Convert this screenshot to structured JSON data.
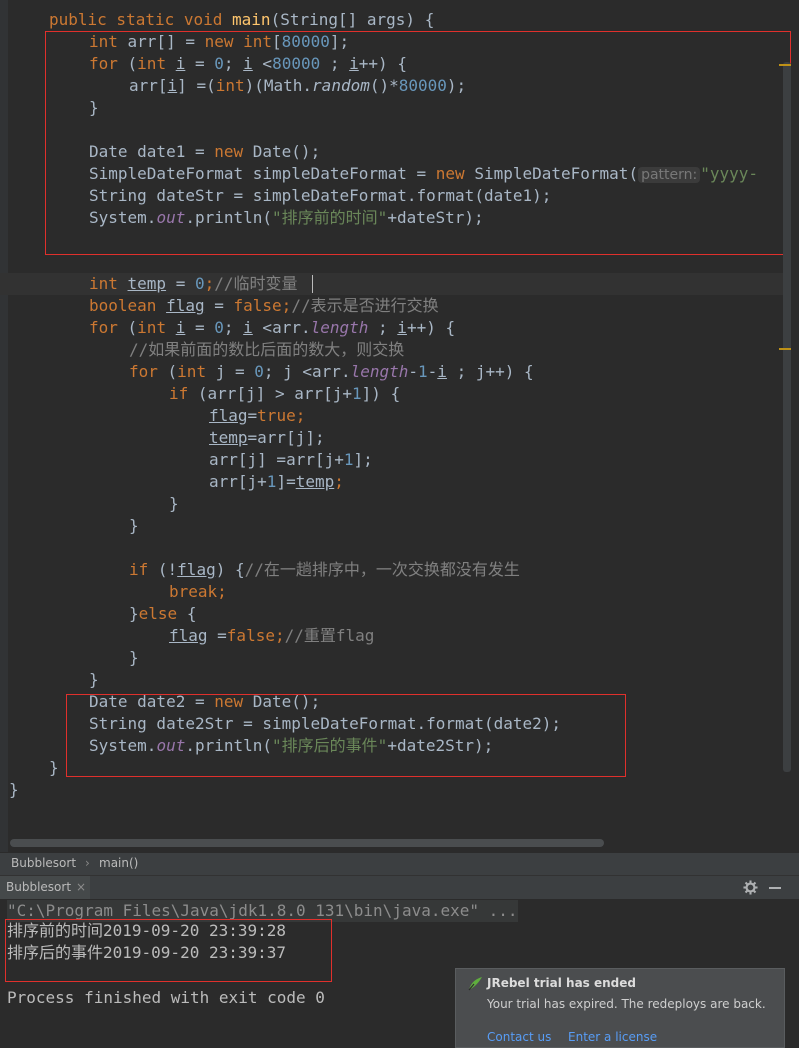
{
  "code": {
    "l1": {
      "a": "public static void ",
      "b": "main",
      "c": "(String[] args) {"
    },
    "l2": {
      "a": "int ",
      "b": "arr[] = ",
      "c": "new int",
      "d": "[",
      "e": "80000",
      "f": "];"
    },
    "l3": {
      "a": "for ",
      "b": "(",
      "c": "int ",
      "d": "i",
      "e": " = ",
      "f": "0",
      "g": "; ",
      "h": "i",
      "i": " <",
      "j": "80000",
      "k": " ; ",
      "l": "i",
      "m": "++) {"
    },
    "l4": {
      "a": "arr[",
      "b": "i",
      "c": "] =(",
      "d": "int",
      "e": ")(Math.",
      "f": "random",
      "g": "()",
      "h": "*",
      "i": "80000",
      "j": ");"
    },
    "l5": "}",
    "l7": {
      "a": "Date date1 = ",
      "b": "new ",
      "c": "Date();"
    },
    "l8": {
      "a": "SimpleDateFormat simpleDateFormat = ",
      "b": "new ",
      "c": "SimpleDateFormat(",
      "d": "pattern:",
      "e": "\"yyyy-"
    },
    "l9": "String dateStr = simpleDateFormat.format(date1);",
    "l10": {
      "a": "System.",
      "b": "out",
      "c": ".println(",
      "d": "\"排序前的时间\"",
      "e": "+dateStr);"
    },
    "l13": {
      "a": "int ",
      "b": "temp",
      "c": " = ",
      "d": "0",
      "e": ";",
      "f": "//临时变量"
    },
    "l14": {
      "a": "boolean ",
      "b": "flag",
      "c": " = ",
      "d": "false",
      "e": ";",
      "f": "//表示是否进行交换"
    },
    "l15": {
      "a": "for ",
      "b": "(",
      "c": "int ",
      "d": "i",
      "e": " = ",
      "f": "0",
      "g": "; ",
      "h": "i",
      "i": " <arr.",
      "j": "length",
      "k": " ; ",
      "l": "i",
      "m": "++) {"
    },
    "l16": "//如果前面的数比后面的数大，则交换",
    "l17": {
      "a": "for ",
      "b": "(",
      "c": "int ",
      "d": "j = ",
      "e": "0",
      "f": "; j <arr.",
      "g": "length",
      "h": "-",
      "i": "1",
      "j": "-",
      "k": "i",
      "l": " ; j++) {"
    },
    "l18": {
      "a": "if ",
      "b": "(arr[j] > arr[j+",
      "c": "1",
      "d": "]) {"
    },
    "l19": {
      "a": "flag",
      "b": "=",
      "c": "true",
      "d": ";"
    },
    "l20": {
      "a": "temp",
      "b": "=arr[j];"
    },
    "l21": {
      "a": "arr[j] =arr[j+",
      "b": "1",
      "c": "];"
    },
    "l22": {
      "a": "arr[j+",
      "b": "1",
      "c": "]=",
      "d": "temp",
      "e": ";"
    },
    "l23": "}",
    "l24": "}",
    "l26": {
      "a": "if ",
      "b": "(!",
      "c": "flag",
      "d": ") {",
      "e": "//在一趟排序中，一次交换都没有发生"
    },
    "l27": {
      "a": "break",
      "b": ";"
    },
    "l28": {
      "a": "}",
      "b": "else ",
      "c": "{"
    },
    "l29": {
      "a": "flag",
      "b": " =",
      "c": "false",
      "d": ";",
      "e": "//重置flag"
    },
    "l30": "}",
    "l31": "}",
    "l32": {
      "a": "Date date2 = ",
      "b": "new ",
      "c": "Date();"
    },
    "l33": "String date2Str = simpleDateFormat.format(date2);",
    "l34": {
      "a": "System.",
      "b": "out",
      "c": ".println(",
      "d": "\"排序后的事件\"",
      "e": "+date2Str);"
    },
    "l35": "}",
    "l36": "}"
  },
  "breadcrumb": {
    "class": "Bubblesort",
    "method": "main()"
  },
  "run_panel": {
    "tab": "Bubblesort",
    "close": "×"
  },
  "console": {
    "cmd": "\"C:\\Program Files\\Java\\jdk1.8.0_131\\bin\\java.exe\" ...",
    "out1": "排序前的时间2019-09-20 23:39:28",
    "out2": "排序后的事件2019-09-20 23:39:37",
    "finish": "Process finished with exit code 0"
  },
  "notification": {
    "title": "JRebel trial has ended",
    "body": "Your trial has expired. The redeploys are back.",
    "link1": "Contact us",
    "link2": "Enter a license"
  }
}
